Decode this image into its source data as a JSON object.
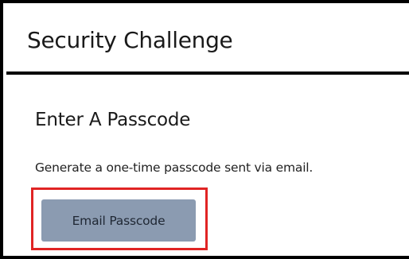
{
  "header": {
    "title": "Security Challenge"
  },
  "passcode_section": {
    "title": "Enter A Passcode",
    "description": "Generate a one-time passcode sent via email.",
    "email_button_label": "Email Passcode"
  },
  "colors": {
    "button_background": "#8b9bb1",
    "highlight_border": "#e02424",
    "frame_border": "#000000"
  }
}
